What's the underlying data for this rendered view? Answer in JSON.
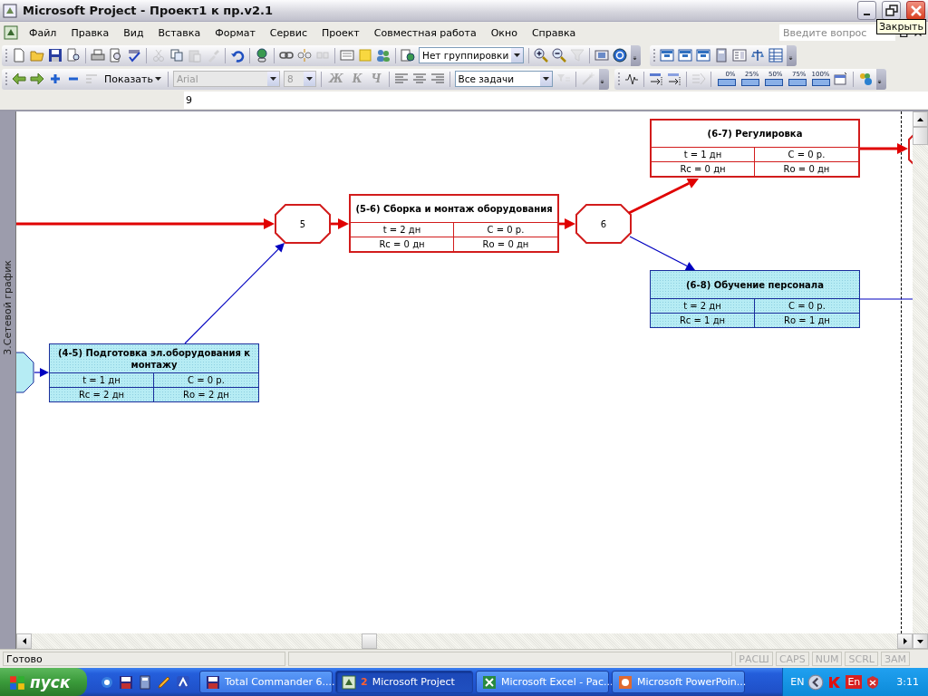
{
  "window": {
    "title": "Microsoft Project - Проект1 к пр.v2.1",
    "tooltip": "Закрыть"
  },
  "menu": {
    "items": [
      "Файл",
      "Правка",
      "Вид",
      "Вставка",
      "Формат",
      "Сервис",
      "Проект",
      "Совместная работа",
      "Окно",
      "Справка"
    ],
    "help_search": {
      "placeholder": "Введите вопрос"
    }
  },
  "toolbar_standard": {
    "grouping_dropdown": "Нет группировки"
  },
  "toolbar_formatting": {
    "show_button": "Показать",
    "font_field": {
      "value": "Arial",
      "disabled": true
    },
    "size_field": {
      "value": "8",
      "disabled": true
    },
    "format_buttons": [
      {
        "label": "Ж",
        "disabled": true
      },
      {
        "label": "К",
        "disabled": true
      },
      {
        "label": "Ч",
        "disabled": true
      }
    ],
    "filter_dropdown": "Все задачи",
    "percent_buttons": [
      "0%",
      "25%",
      "50%",
      "75%",
      "100%"
    ]
  },
  "entry_bar": {
    "value": "9"
  },
  "view_bar": {
    "label": "3.Сетевой график"
  },
  "network": {
    "nodes": [
      {
        "kind": "event",
        "label": "5",
        "critical": true
      },
      {
        "kind": "task",
        "title": "(5-6) Сборка и монтаж оборудования",
        "cells": [
          "t = 2 дн",
          "C = 0 р.",
          "Rс = 0 дн",
          "Rо = 0 дн"
        ],
        "critical": true
      },
      {
        "kind": "event",
        "label": "6",
        "critical": true
      },
      {
        "kind": "task",
        "title": "(6-7) Регулировка",
        "cells": [
          "t = 1 дн",
          "C = 0 р.",
          "Rс = 0 дн",
          "Rо = 0 дн"
        ],
        "critical": true
      },
      {
        "kind": "task",
        "title": "(6-8) Обучение персонала",
        "cells": [
          "t = 2 дн",
          "C = 0 р.",
          "Rс = 1 дн",
          "Rо = 1 дн"
        ],
        "critical": false
      },
      {
        "kind": "task",
        "title": "(4-5) Подготовка эл.оборудования к монтажу",
        "cells": [
          "t = 1 дн",
          "C = 0 р.",
          "Rс = 2 дн",
          "Rо = 2 дн"
        ],
        "critical": false
      },
      {
        "kind": "event",
        "critical": false
      },
      {
        "kind": "event",
        "critical": true
      }
    ],
    "links": [
      {
        "critical": true
      },
      {
        "critical": true
      },
      {
        "critical": true
      },
      {
        "critical": true
      },
      {
        "critical": true
      },
      {
        "critical": false
      },
      {
        "critical": false
      },
      {
        "critical": false
      },
      {
        "critical": false
      }
    ]
  },
  "status_bar": {
    "message": "Готово",
    "indicators": [
      {
        "label": "РАСШ",
        "on": false
      },
      {
        "label": "CAPS",
        "on": false
      },
      {
        "label": "NUM",
        "on": false
      },
      {
        "label": "SCRL",
        "on": false
      },
      {
        "label": "ЗАМ",
        "on": false
      }
    ]
  },
  "taskbar": {
    "start": "пуск",
    "tasks": [
      {
        "label": "Total Commander 6....",
        "selected": false
      },
      {
        "label": "Microsoft Project",
        "count": "2",
        "selected": true
      },
      {
        "label": "Microsoft Excel - Рас...",
        "selected": false
      },
      {
        "label": "Microsoft PowerPoin...",
        "selected": false
      }
    ],
    "language": "EN",
    "keyboard": "En",
    "clock": "3:11"
  }
}
